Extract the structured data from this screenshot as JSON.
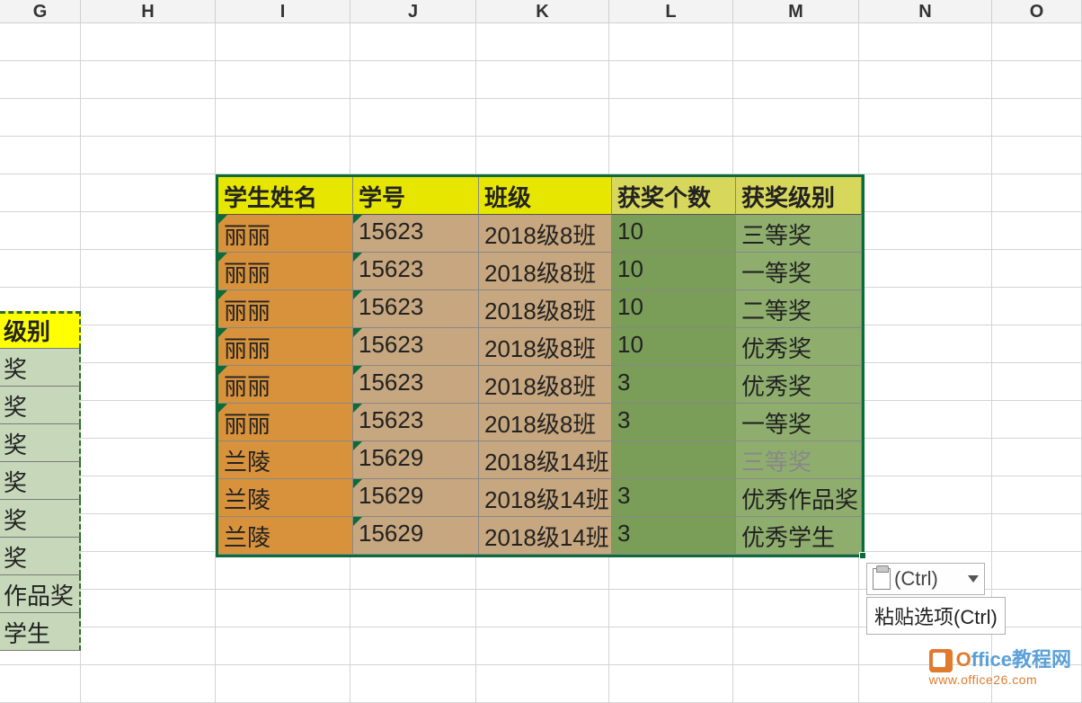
{
  "columns": [
    "G",
    "H",
    "I",
    "J",
    "K",
    "L",
    "M",
    "N",
    "O"
  ],
  "left_fragment": {
    "header": "级别",
    "rows": [
      "奖",
      "奖",
      "奖",
      "奖",
      "奖",
      "奖",
      "作品奖",
      "学生"
    ]
  },
  "main_table": {
    "headers": [
      "学生姓名",
      "学号",
      "班级",
      "获奖个数",
      "获奖级别"
    ],
    "rows": [
      [
        "丽丽",
        "15623",
        "2018级8班",
        "10",
        "三等奖"
      ],
      [
        "丽丽",
        "15623",
        "2018级8班",
        "10",
        "一等奖"
      ],
      [
        "丽丽",
        "15623",
        "2018级8班",
        "10",
        "二等奖"
      ],
      [
        "丽丽",
        "15623",
        "2018级8班",
        "10",
        "优秀奖"
      ],
      [
        "丽丽",
        "15623",
        "2018级8班",
        "3",
        "优秀奖"
      ],
      [
        "丽丽",
        "15623",
        "2018级8班",
        "3",
        "一等奖"
      ],
      [
        "兰陵",
        "15629",
        "2018级14班",
        "",
        "三等奖"
      ],
      [
        "兰陵",
        "15629",
        "2018级14班",
        "3",
        "优秀作品奖"
      ],
      [
        "兰陵",
        "15629",
        "2018级14班",
        "3",
        "优秀学生"
      ]
    ]
  },
  "paste_button": {
    "label": "(Ctrl)",
    "tooltip": "粘贴选项(Ctrl)"
  },
  "watermark": {
    "brand_prefix": "O",
    "brand_rest": "ffice教程网",
    "url": "www.office26.com"
  }
}
